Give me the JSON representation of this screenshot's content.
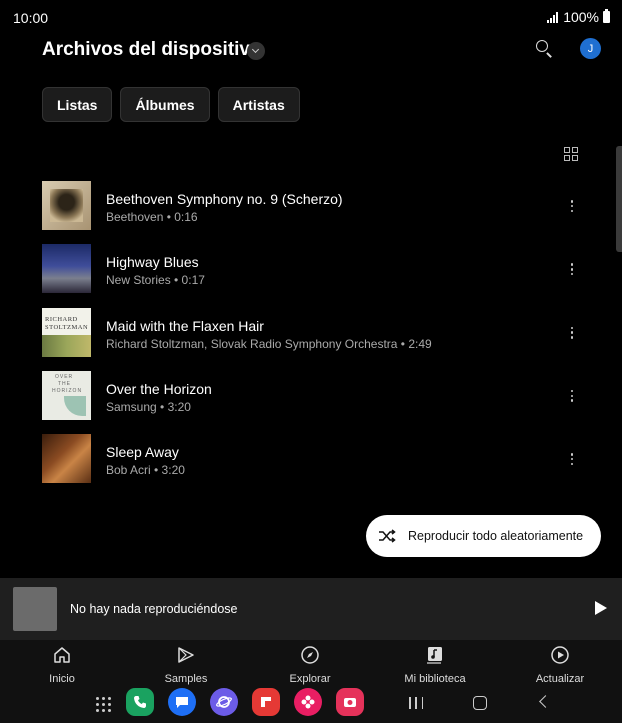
{
  "status_bar": {
    "time": "10:00",
    "battery": "100%"
  },
  "header": {
    "title": "Archivos del dispositivo",
    "avatar_initial": "J"
  },
  "chips": [
    {
      "label": "Listas"
    },
    {
      "label": "Álbumes"
    },
    {
      "label": "Artistas"
    }
  ],
  "songs": [
    {
      "title": "Beethoven Symphony no. 9 (Scherzo)",
      "subtitle": "Beethoven • 0:16"
    },
    {
      "title": "Highway Blues",
      "subtitle": "New Stories • 0:17"
    },
    {
      "title": "Maid with the Flaxen Hair",
      "subtitle": "Richard Stoltzman, Slovak Radio Symphony Orchestra • 2:49"
    },
    {
      "title": "Over the Horizon",
      "subtitle": "Samsung • 3:20"
    },
    {
      "title": "Sleep Away",
      "subtitle": "Bob Acri • 3:20"
    }
  ],
  "album_art_text": {
    "maid_line1": "RICHARD",
    "maid_line2": "STOLTZMAN",
    "horizon_1": "OVER",
    "horizon_2": "THE",
    "horizon_3": "HORIZON"
  },
  "shuffle": {
    "label": "Reproducir todo aleatoriamente"
  },
  "mini_player": {
    "text": "No hay nada reproduciéndose"
  },
  "bottom_nav": [
    {
      "label": "Inicio",
      "icon": "home-icon"
    },
    {
      "label": "Samples",
      "icon": "samples-icon"
    },
    {
      "label": "Explorar",
      "icon": "compass-icon"
    },
    {
      "label": "Mi biblioteca",
      "icon": "library-icon"
    },
    {
      "label": "Actualizar",
      "icon": "update-icon"
    }
  ],
  "colors": {
    "background": "#000000",
    "avatar": "#1f6fd1",
    "mini_player": "#1f1f1f",
    "dock_phone": "#1aa260",
    "dock_messages": "#1e6ff5",
    "dock_internet": "#6c5ce7",
    "dock_flipboard": "#e53935",
    "dock_blossom": "#e91e63",
    "dock_camera": "#e5325a"
  }
}
